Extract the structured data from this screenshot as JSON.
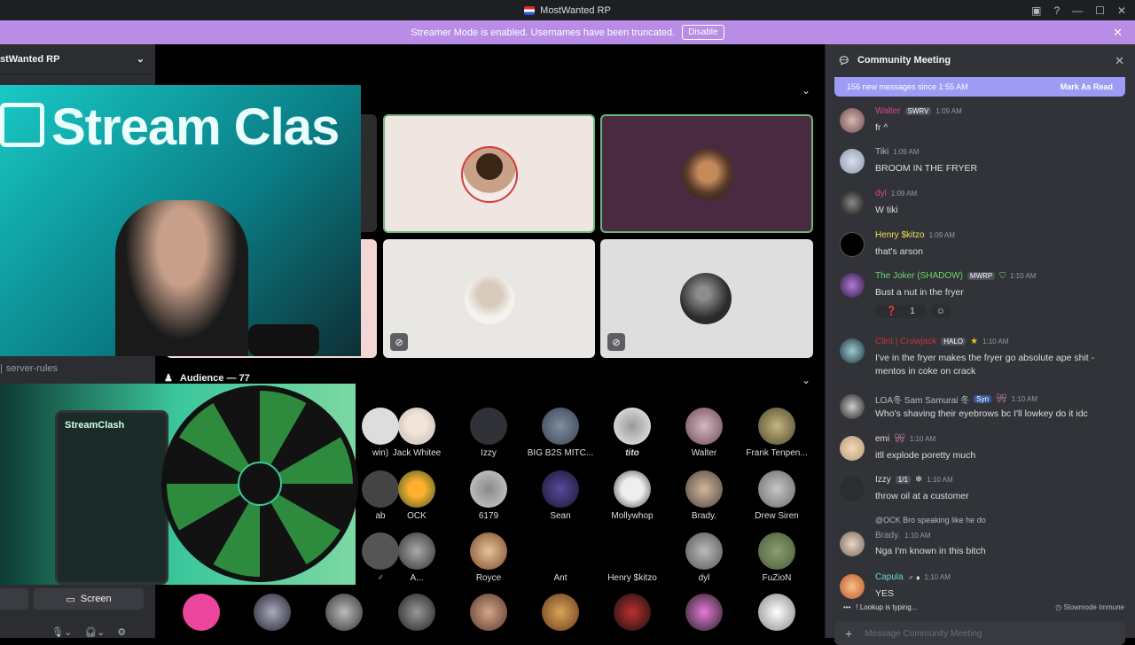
{
  "app": {
    "title": "MostWanted RP"
  },
  "banner": {
    "text": "Streamer Mode is enabled. Usernames have been truncated.",
    "disable_label": "Disable"
  },
  "sidebar": {
    "server_name": "stWanted RP",
    "channel_rules": "server-rules",
    "screen_label": "Screen"
  },
  "stage": {
    "audience_label": "Audience — 77"
  },
  "audience": [
    {
      "name": "win)"
    },
    {
      "name": "Jack Whitee"
    },
    {
      "name": "Izzy"
    },
    {
      "name": "BIG B2S MITC..."
    },
    {
      "name": "tito"
    },
    {
      "name": "Walter"
    },
    {
      "name": "Frank Tenpen..."
    },
    {
      "name": "ab"
    },
    {
      "name": "OCK"
    },
    {
      "name": "6179"
    },
    {
      "name": "Sean"
    },
    {
      "name": "Mollywhop"
    },
    {
      "name": "Brady."
    },
    {
      "name": "Drew Siren"
    },
    {
      "name": "♂"
    },
    {
      "name": "A..."
    },
    {
      "name": "Royce"
    },
    {
      "name": "Ant"
    },
    {
      "name": "Henry $kitzo"
    },
    {
      "name": "dyl"
    },
    {
      "name": "FuZioN"
    }
  ],
  "overlay": {
    "cam_brand": "Stream Clas",
    "cam2_brand": "StreamClash"
  },
  "chat": {
    "title": "Community Meeting",
    "new_messages": "156 new messages since 1:55 AM",
    "mark_read": "Mark As Read",
    "messages": [
      {
        "user": "Walter",
        "tag": "SWRV",
        "time": "1:09 AM",
        "text": "fr ^",
        "color": "#d7478c"
      },
      {
        "user": "Tiki",
        "tag": "",
        "time": "1:09 AM",
        "text": "BROOM IN THE FRYER",
        "color": "#b5bac1"
      },
      {
        "user": "dyl",
        "tag": "",
        "time": "1:09 AM",
        "text": "W tiki",
        "color": "#d7478c"
      },
      {
        "user": "Henry $kitzo",
        "tag": "",
        "time": "1:09 AM",
        "text": "that's arson",
        "color": "#f0e154"
      },
      {
        "user": "The Joker (SHADOW)",
        "tag": "MWRP",
        "time": "1:10 AM",
        "text": "Bust a nut in the fryer",
        "color": "#6bd86b"
      },
      {
        "user": "Clint | Crowjack",
        "tag": "HALO",
        "time": "1:10 AM",
        "text": "I've in the fryer makes the fryer go absolute ape shit - mentos in coke on crack",
        "color": "#c0343b"
      },
      {
        "user": "LOA冬 Sam Samurai 冬",
        "tag": "Syn",
        "time": "1:10 AM",
        "text": "Who's shaving their eyebrows bc I'll lowkey do it idc",
        "color": "#b5bac1"
      },
      {
        "user": "emi",
        "tag": "",
        "time": "1:10 AM",
        "text": "itll explode poretty much",
        "color": "#dbdee1"
      },
      {
        "user": "Izzy",
        "tag": "1/1",
        "time": "1:10 AM",
        "text": "throw oil at a customer",
        "color": "#dbdee1"
      },
      {
        "user": "Brady.",
        "tag": "",
        "time": "1:10 AM",
        "text": "Nga  I'm known in this bitch",
        "color": "#949ba4",
        "reply": "@OCK  Bro speaking like he do"
      },
      {
        "user": "Capula",
        "tag": "",
        "time": "1:10 AM",
        "text": "YES",
        "color": "#f0e154"
      }
    ],
    "reaction_count": "1",
    "typing": "! Lookup is typing...",
    "slowmode": "Slowmode Immune",
    "input_placeholder": "Message Community Meeting"
  }
}
